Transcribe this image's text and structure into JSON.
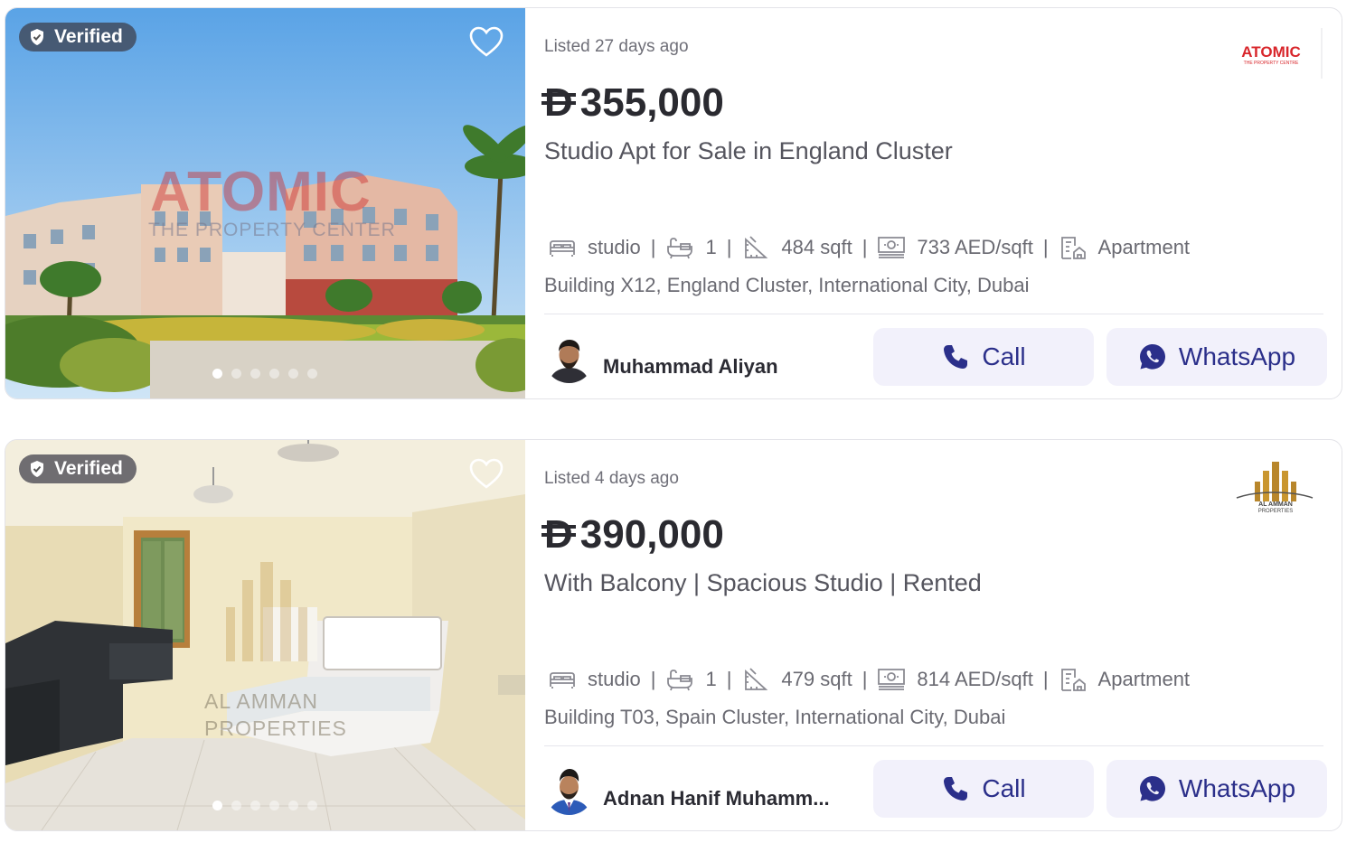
{
  "listings": [
    {
      "badge": "Verified",
      "listed": "Listed 27 days ago",
      "agency_logo_text": "ATOMIC",
      "agency_logo_sub": "THE PROPERTY CENTRE",
      "currency_symbol": "D",
      "price": "355,000",
      "title": "Studio Apt for Sale in England Cluster",
      "beds": "studio",
      "baths": "1",
      "area": "484 sqft",
      "price_per_sqft": "733 AED/sqft",
      "type": "Apartment",
      "address": "Building X12, England Cluster, International City, Dubai",
      "agent_name": "Muhammad Aliyan",
      "call_label": "Call",
      "whatsapp_label": "WhatsApp",
      "photo_count": 6,
      "photo_index": 1,
      "watermark_main": "ATOMIC",
      "watermark_sub": "THE PROPERTY CENTER"
    },
    {
      "badge": "Verified",
      "listed": "Listed 4 days ago",
      "agency_logo_text": "AL AMMAN",
      "agency_logo_sub": "PROPERTIES",
      "currency_symbol": "D",
      "price": "390,000",
      "title": "With Balcony | Spacious Studio | Rented",
      "beds": "studio",
      "baths": "1",
      "area": "479 sqft",
      "price_per_sqft": "814 AED/sqft",
      "type": "Apartment",
      "address": "Building T03, Spain Cluster, International City, Dubai",
      "agent_name": "Adnan Hanif Muhamm...",
      "call_label": "Call",
      "whatsapp_label": "WhatsApp",
      "photo_count": 6,
      "photo_index": 1,
      "watermark_main": "AL AMMAN",
      "watermark_sub": "PROPERTIES"
    }
  ],
  "colors": {
    "button_bg": "#f2f1fb",
    "button_text": "#2b2f8a",
    "atomic_red": "#d8262b",
    "alamman_gold": "#b8862b"
  }
}
